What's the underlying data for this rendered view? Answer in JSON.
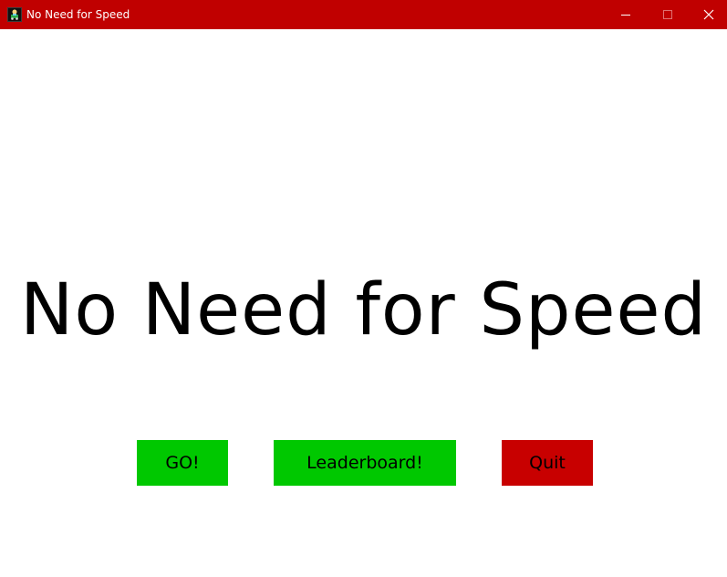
{
  "window": {
    "title": "No Need for Speed",
    "icon": "car-game-icon",
    "controls": {
      "minimize": "minimize-icon",
      "maximize": "maximize-icon",
      "close": "close-icon"
    },
    "titlebar_color": "#c00000"
  },
  "menu": {
    "heading": "No Need for Speed",
    "buttons": {
      "go_label": "GO!",
      "leaderboard_label": "Leaderboard!",
      "quit_label": "Quit"
    },
    "colors": {
      "go": "#00c800",
      "leaderboard": "#00c800",
      "quit": "#c80000"
    }
  }
}
